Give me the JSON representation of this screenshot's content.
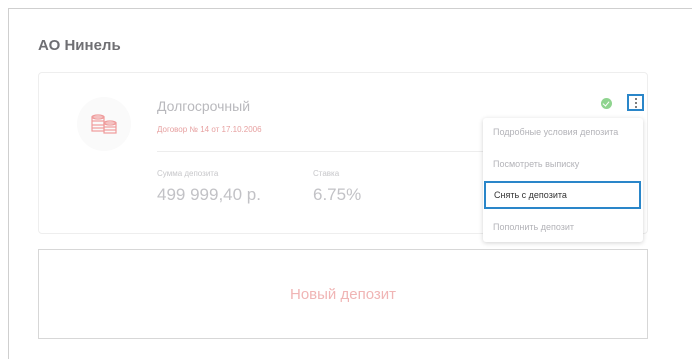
{
  "org": {
    "title": "АО Нинель"
  },
  "deposit": {
    "name": "Долгосрочный",
    "contract": "Договор № 14 от 17.10.2006",
    "amount_label": "Сумма депозита",
    "amount_value": "499 999,40 р.",
    "rate_label": "Ставка",
    "rate_value": "6.75%",
    "status_icon": "check-circle-icon",
    "menu_icon": "kebab-menu-icon"
  },
  "menu": {
    "items": [
      {
        "label": "Подробные условия депозита"
      },
      {
        "label": "Посмотреть выписку"
      },
      {
        "label": "Снять с депозита"
      },
      {
        "label": "Пополнить депозит"
      }
    ]
  },
  "new_deposit": {
    "label": "Новый депозит"
  },
  "colors": {
    "accent": "#2a86c9",
    "status_ok": "#8fd48f",
    "brand_pink": "#f0b5b5"
  }
}
